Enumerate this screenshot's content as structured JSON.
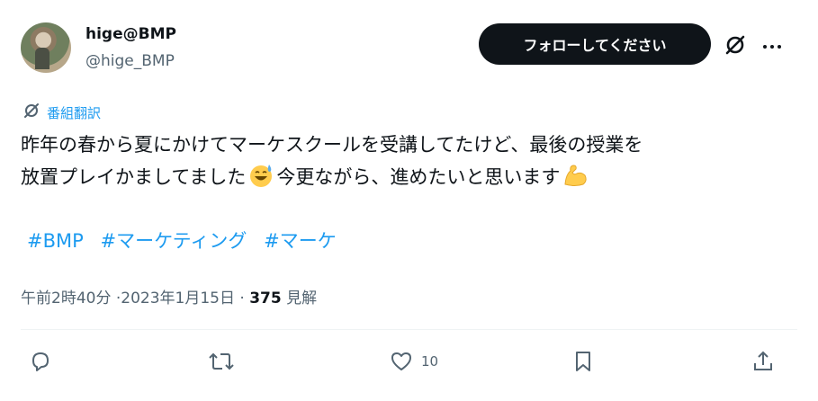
{
  "author": {
    "display_name": "hige@BMP",
    "handle": "@hige_BMP"
  },
  "follow_button": "フォローしてください",
  "translate_label": "番組翻訳",
  "tweet": {
    "line1": "昨年の春から夏にかけてマーケスクールを受講してたけど、最後の授業を",
    "line2_a": "放置プレイかましてました",
    "line2_b": "今更ながら、進めたいと思います",
    "hashtags": [
      "#BMP",
      "#マーケティング",
      "#マーケ"
    ]
  },
  "meta": {
    "time_date": "午前2時40分 ·2023年1月15日 · ",
    "views_count": "375",
    "views_label": " 見解"
  },
  "actions": {
    "like_count": "10"
  },
  "colors": {
    "accent": "#1d9bf0",
    "text": "#0f1419",
    "muted": "#536471",
    "button_bg": "#0f1419"
  },
  "icons": [
    "grok-icon",
    "more-icon",
    "translate-icon",
    "reply-icon",
    "retweet-icon",
    "like-icon",
    "bookmark-icon",
    "share-icon",
    "sweat-smile-emoji",
    "flexed-biceps-emoji"
  ]
}
